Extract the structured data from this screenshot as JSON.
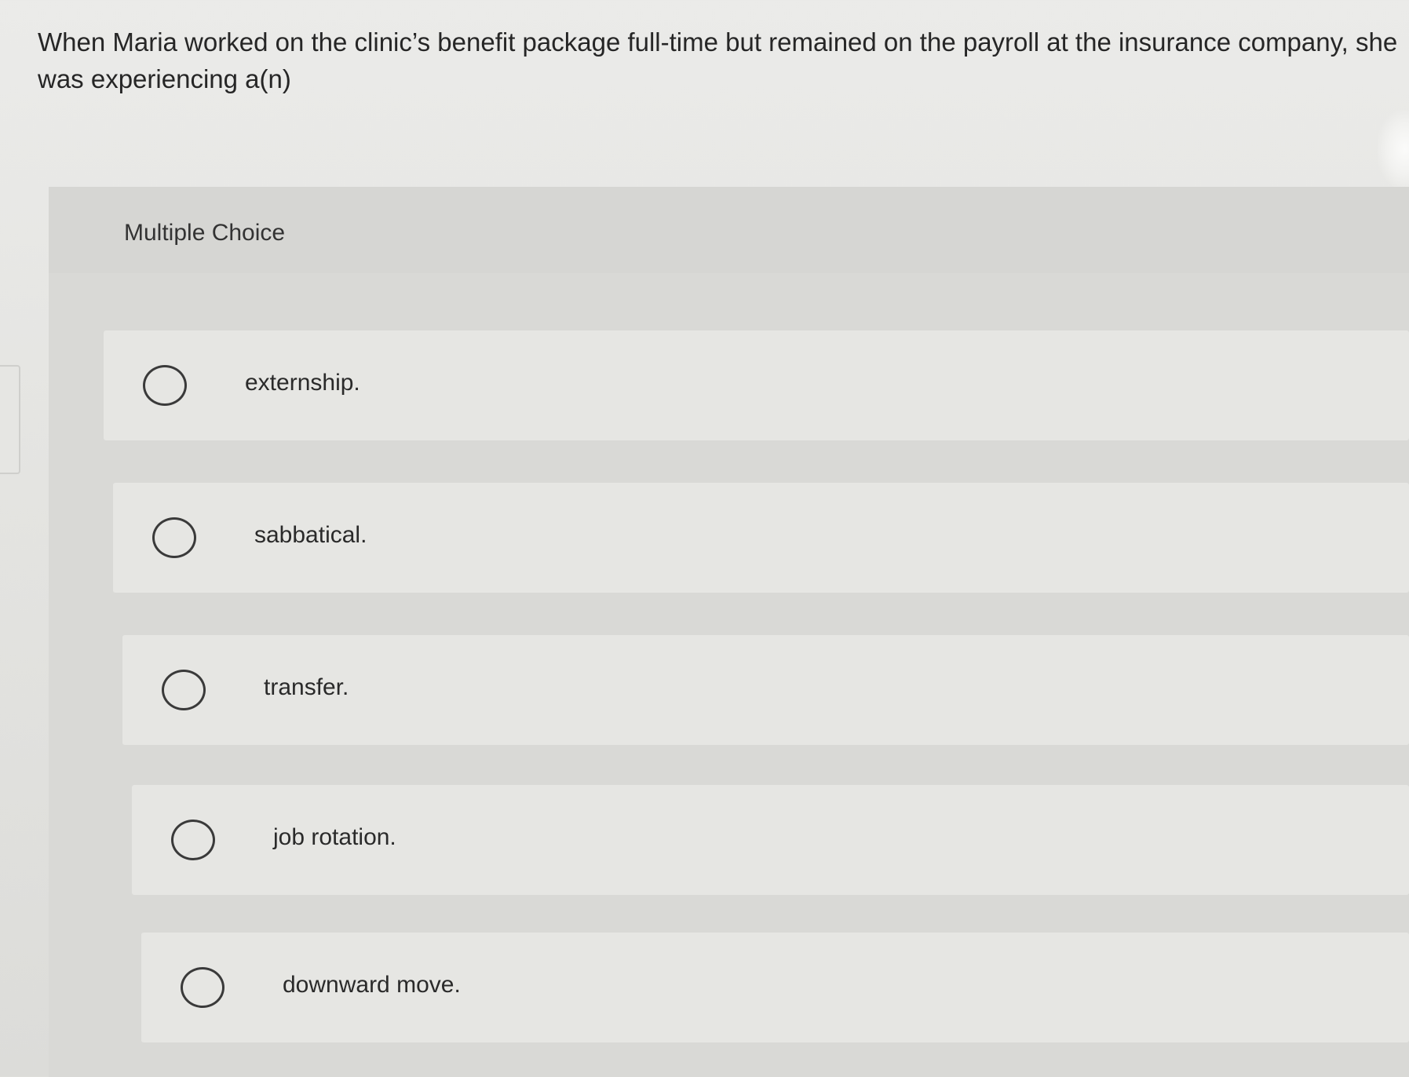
{
  "question": {
    "line1": "When Maria worked on the clinic’s benefit package full-time but remained on the payroll at the insurance company, she",
    "line2": "was experiencing a(n)"
  },
  "multiple_choice": {
    "title": "Multiple Choice",
    "options": [
      {
        "label": "externship."
      },
      {
        "label": "sabbatical."
      },
      {
        "label": "transfer."
      },
      {
        "label": "job rotation."
      },
      {
        "label": "downward move."
      }
    ]
  }
}
